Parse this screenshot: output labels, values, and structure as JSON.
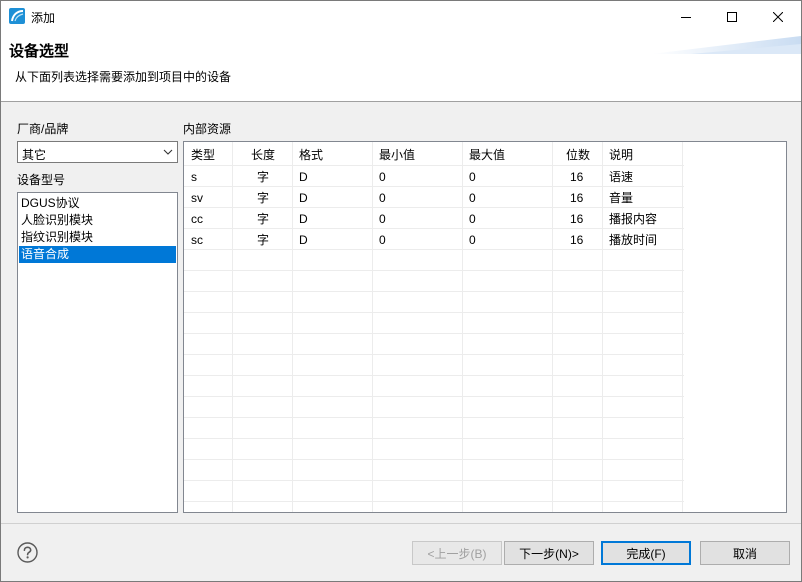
{
  "window": {
    "title": "添加"
  },
  "banner": {
    "title": "设备选型",
    "description": "从下面列表选择需要添加到项目中的设备"
  },
  "left": {
    "vendor_label": "厂商/品牌",
    "vendor_value": "其它",
    "model_label": "设备型号",
    "models": [
      "DGUS协议",
      "人脸识别模块",
      "指纹识别模块",
      "语音合成"
    ],
    "selected_model": "语音合成"
  },
  "resources": {
    "label": "内部资源",
    "headers": [
      "类型",
      "长度",
      "格式",
      "最小值",
      "最大值",
      "位数",
      "说明"
    ],
    "rows": [
      [
        "s",
        "字",
        "D",
        "0",
        "0",
        "16",
        "语速"
      ],
      [
        "sv",
        "字",
        "D",
        "0",
        "0",
        "16",
        "音量"
      ],
      [
        "cc",
        "字",
        "D",
        "0",
        "0",
        "16",
        "播报内容"
      ],
      [
        "sc",
        "字",
        "D",
        "0",
        "0",
        "16",
        "播放时间"
      ]
    ]
  },
  "buttons": {
    "back": "<上一步(B)",
    "next": "下一步(N)>",
    "finish": "完成(F)",
    "cancel": "取消"
  },
  "colors": {
    "selection": "#0078d7",
    "accent": "#0078d7"
  }
}
